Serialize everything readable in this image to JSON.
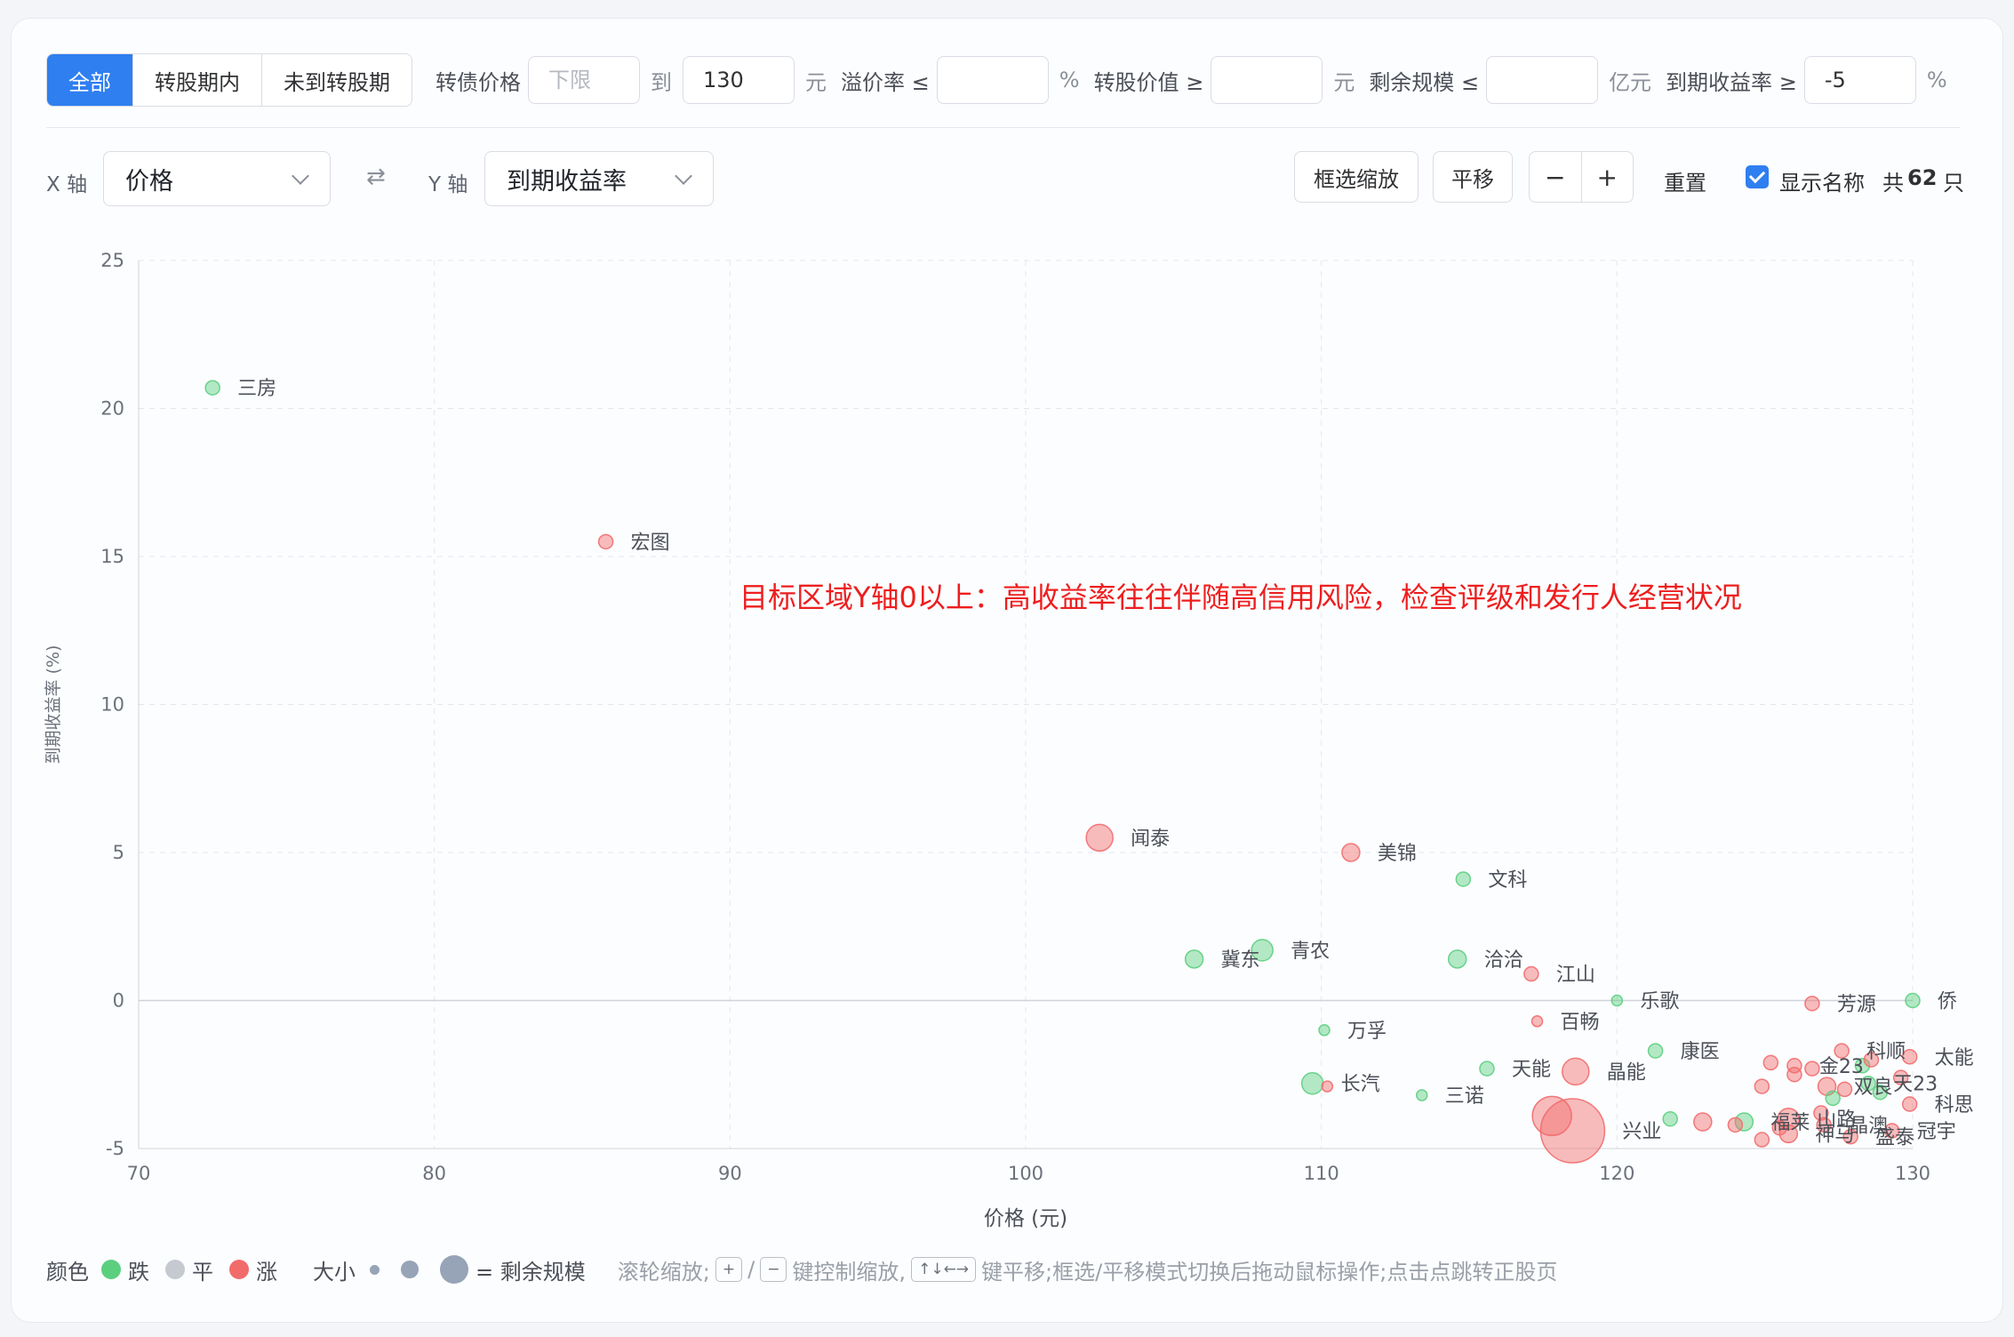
{
  "filters": {
    "tabs": [
      {
        "label": "全部",
        "active": true
      },
      {
        "label": "转股期内",
        "active": false
      },
      {
        "label": "未到转股期",
        "active": false
      }
    ],
    "price_label": "转债价格",
    "price_min_placeholder": "下限",
    "price_to": "到",
    "price_max": "130",
    "price_unit": "元",
    "premium_label": "溢价率 ≤",
    "premium_value": "",
    "premium_unit": "%",
    "conv_value_label": "转股价值 ≥",
    "conv_value": "",
    "conv_value_unit": "元",
    "remaining_label": "剩余规模 ≤",
    "remaining_value": "",
    "remaining_unit": "亿元",
    "ytm_label": "到期收益率 ≥",
    "ytm_value": "-5",
    "ytm_unit": "%"
  },
  "axes": {
    "x_label": "X 轴",
    "x_value": "价格",
    "swap_icon": "⇄",
    "y_label": "Y 轴",
    "y_value": "到期收益率"
  },
  "toolbar": {
    "box_zoom": "框选缩放",
    "pan": "平移",
    "zoom_out": "−",
    "zoom_in": "+",
    "reset": "重置",
    "show_names": "显示名称",
    "show_names_checked": true,
    "count_prefix": "共",
    "count": "62",
    "count_suffix": "只"
  },
  "annotation": "目标区域Y轴0以上：高收益率往往伴随高信用风险，检查评级和发行人经营状况",
  "legend": {
    "color_label": "颜色",
    "down": "跌",
    "flat": "平",
    "up": "涨",
    "size_label": "大小",
    "size_desc": "= 剩余规模",
    "hint_1": "滚轮缩放;",
    "hint_key_plus": "+",
    "hint_sep": "/",
    "hint_key_minus": "−",
    "hint_2": "键控制缩放,",
    "hint_key_arrows": "↑↓←→",
    "hint_3": "键平移;框选/平移模式切换后拖动鼠标操作;点击点跳转正股页",
    "colors": {
      "down": "#5ccf7f",
      "flat": "#c5c9d0",
      "up": "#f26b6b",
      "size": "#97a3b6"
    }
  },
  "chart_data": {
    "type": "scatter",
    "title": "",
    "xlabel": "价格 (元)",
    "ylabel": "到期收益率 (%)",
    "xlim": [
      70,
      130
    ],
    "ylim": [
      -5,
      25
    ],
    "xticks": [
      70,
      80,
      90,
      100,
      110,
      120,
      130
    ],
    "yticks": [
      -5,
      0,
      5,
      10,
      15,
      20,
      25
    ],
    "grid": true,
    "colors": {
      "down": "#5ccf7f",
      "up": "#f26b6b"
    },
    "points": [
      {
        "name": "三房",
        "x": 72.5,
        "y": 20.7,
        "trend": "down",
        "size": 1
      },
      {
        "name": "宏图",
        "x": 85.8,
        "y": 15.5,
        "trend": "up",
        "size": 1
      },
      {
        "name": "闻泰",
        "x": 102.5,
        "y": 5.5,
        "trend": "up",
        "size": 4
      },
      {
        "name": "美锦",
        "x": 111.0,
        "y": 5.0,
        "trend": "up",
        "size": 2
      },
      {
        "name": "文科",
        "x": 114.8,
        "y": 4.1,
        "trend": "down",
        "size": 1
      },
      {
        "name": "冀东",
        "x": 105.7,
        "y": 1.4,
        "trend": "down",
        "size": 2
      },
      {
        "name": "青农",
        "x": 108.0,
        "y": 1.7,
        "trend": "down",
        "size": 3
      },
      {
        "name": "洽洽",
        "x": 114.6,
        "y": 1.4,
        "trend": "down",
        "size": 2
      },
      {
        "name": "江山",
        "x": 117.1,
        "y": 0.9,
        "trend": "up",
        "size": 1
      },
      {
        "name": "乐歌",
        "x": 120.0,
        "y": 0.0,
        "trend": "down",
        "size": 0
      },
      {
        "name": "芳源",
        "x": 126.6,
        "y": -0.1,
        "trend": "up",
        "size": 1
      },
      {
        "name": "侨",
        "x": 130.0,
        "y": 0.0,
        "trend": "down",
        "size": 1
      },
      {
        "name": "百畅",
        "x": 117.3,
        "y": -0.7,
        "trend": "up",
        "size": 0
      },
      {
        "name": "万孚",
        "x": 110.1,
        "y": -1.0,
        "trend": "down",
        "size": 0
      },
      {
        "name": "康医",
        "x": 121.3,
        "y": -1.7,
        "trend": "down",
        "size": 1
      },
      {
        "name": "天能",
        "x": 115.6,
        "y": -2.3,
        "trend": "down",
        "size": 1
      },
      {
        "name": "晶能",
        "x": 118.6,
        "y": -2.4,
        "trend": "up",
        "size": 4
      },
      {
        "name": "长汽",
        "x": 109.7,
        "y": -2.8,
        "trend": "down",
        "size": 3
      },
      {
        "name": "",
        "x": 110.2,
        "y": -2.9,
        "trend": "up",
        "size": 0
      },
      {
        "name": "三诺",
        "x": 113.4,
        "y": -3.2,
        "trend": "down",
        "size": 0
      },
      {
        "name": "兴业",
        "x": 118.5,
        "y": -4.4,
        "trend": "up",
        "size": 6
      },
      {
        "name": "",
        "x": 117.8,
        "y": -3.9,
        "trend": "up",
        "size": 5
      },
      {
        "name": "",
        "x": 121.8,
        "y": -4.0,
        "trend": "down",
        "size": 1
      },
      {
        "name": "",
        "x": 122.9,
        "y": -4.1,
        "trend": "up",
        "size": 2
      },
      {
        "name": "福莱",
        "x": 124.3,
        "y": -4.1,
        "trend": "down",
        "size": 2
      },
      {
        "name": "山路",
        "x": 125.8,
        "y": -4.0,
        "trend": "up",
        "size": 3
      },
      {
        "name": "晶澳",
        "x": 127.0,
        "y": -4.2,
        "trend": "up",
        "size": 1
      },
      {
        "name": "神马",
        "x": 125.8,
        "y": -4.5,
        "trend": "up",
        "size": 2
      },
      {
        "name": "盛泰",
        "x": 127.9,
        "y": -4.6,
        "trend": "up",
        "size": 1
      },
      {
        "name": "冠宇",
        "x": 129.3,
        "y": -4.4,
        "trend": "up",
        "size": 1
      },
      {
        "name": "",
        "x": 124.9,
        "y": -4.7,
        "trend": "up",
        "size": 1
      },
      {
        "name": "",
        "x": 124.0,
        "y": -4.2,
        "trend": "up",
        "size": 1
      },
      {
        "name": "金23",
        "x": 126.0,
        "y": -2.2,
        "trend": "up",
        "size": 1
      },
      {
        "name": "科顺",
        "x": 127.6,
        "y": -1.7,
        "trend": "up",
        "size": 1
      },
      {
        "name": "太能",
        "x": 129.9,
        "y": -1.9,
        "trend": "up",
        "size": 1
      },
      {
        "name": "双良",
        "x": 127.1,
        "y": -2.9,
        "trend": "up",
        "size": 2
      },
      {
        "name": "天23",
        "x": 128.5,
        "y": -2.8,
        "trend": "down",
        "size": 1
      },
      {
        "name": "科思",
        "x": 129.9,
        "y": -3.5,
        "trend": "up",
        "size": 1
      },
      {
        "name": "",
        "x": 125.2,
        "y": -2.1,
        "trend": "up",
        "size": 1
      },
      {
        "name": "",
        "x": 126.0,
        "y": -2.5,
        "trend": "up",
        "size": 1
      },
      {
        "name": "",
        "x": 124.9,
        "y": -2.9,
        "trend": "up",
        "size": 1
      },
      {
        "name": "",
        "x": 126.6,
        "y": -2.3,
        "trend": "up",
        "size": 1
      },
      {
        "name": "",
        "x": 127.3,
        "y": -3.3,
        "trend": "down",
        "size": 1
      },
      {
        "name": "",
        "x": 128.3,
        "y": -2.2,
        "trend": "down",
        "size": 1
      },
      {
        "name": "",
        "x": 128.9,
        "y": -3.1,
        "trend": "down",
        "size": 1
      },
      {
        "name": "",
        "x": 129.6,
        "y": -2.6,
        "trend": "up",
        "size": 1
      },
      {
        "name": "",
        "x": 126.9,
        "y": -3.8,
        "trend": "up",
        "size": 1
      },
      {
        "name": "",
        "x": 125.5,
        "y": -4.3,
        "trend": "up",
        "size": 1
      },
      {
        "name": "",
        "x": 127.7,
        "y": -3.0,
        "trend": "up",
        "size": 1
      },
      {
        "name": "",
        "x": 128.6,
        "y": -2.0,
        "trend": "up",
        "size": 1
      }
    ]
  }
}
